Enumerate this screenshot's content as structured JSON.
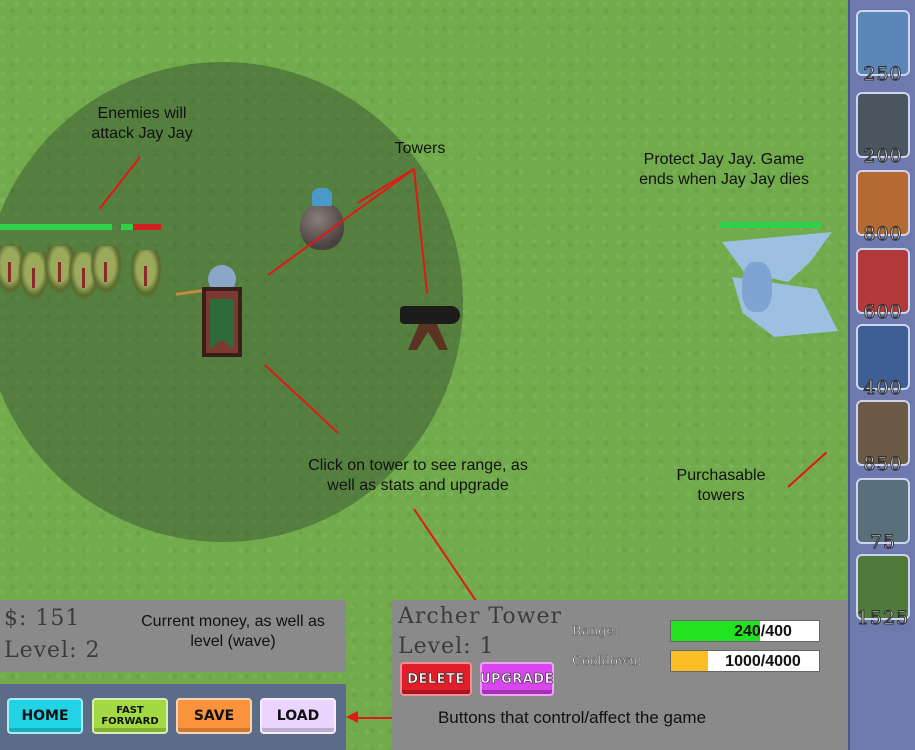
{
  "annotations": {
    "enemies": "Enemies will\nattack Jay Jay",
    "towers": "Towers",
    "protect": "Protect Jay Jay. Game\nends when Jay Jay dies",
    "click_tower": "Click on tower to see range, as\nwell as stats and upgrade",
    "purchasable": "Purchasable\ntowers",
    "money": "Current money, as well as\nlevel (wave)",
    "buttons": "Buttons that control/affect the game"
  },
  "shop": {
    "items": [
      {
        "icon": "knight-icon",
        "price": "250",
        "color": "#5b86b8"
      },
      {
        "icon": "cannon-icon",
        "price": "200",
        "color": "#4a5560"
      },
      {
        "icon": "fortress-icon",
        "price": "800",
        "color": "#b56a34"
      },
      {
        "icon": "mage-icon",
        "price": "600",
        "color": "#b33a3a"
      },
      {
        "icon": "wizard-icon",
        "price": "400",
        "color": "#3e5e96"
      },
      {
        "icon": "dwarf-icon",
        "price": "850",
        "color": "#6a5a46"
      },
      {
        "icon": "crossbow-icon",
        "price": "75",
        "color": "#5a6f7c"
      },
      {
        "icon": "goblin-icon",
        "price": "1525",
        "color": "#4f7a3a"
      }
    ]
  },
  "status": {
    "money": "$: 151",
    "level": "Level: 2"
  },
  "controls": {
    "home": "HOME",
    "fast_forward": "FAST\nFORWARD",
    "save": "SAVE",
    "load": "LOAD"
  },
  "selected_tower": {
    "name": "Archer Tower",
    "level": "Level: 1",
    "range_label": "Range:",
    "range_value": "240/400",
    "range_fraction": 0.6,
    "cooldown_label": "Cooldown:",
    "cooldown_value": "1000/4000",
    "cooldown_fraction": 0.25,
    "delete": "DELETE",
    "upgrade": "UPGRADE"
  },
  "health": {
    "enemy_bar_1_fraction": 1.0,
    "enemy_bar_2_fraction": 0.3,
    "jay_jay_fraction": 1.0
  },
  "colors": {
    "range_fill": "#22e322",
    "cooldown_fill": "#fbbf24",
    "home_btn": "#22d3e6",
    "ff_btn": "#a3d942",
    "save_btn": "#fb923c",
    "load_btn": "#e9d5ff",
    "delete_btn": "#e11d2a",
    "upgrade_btn": "#d946ef"
  }
}
